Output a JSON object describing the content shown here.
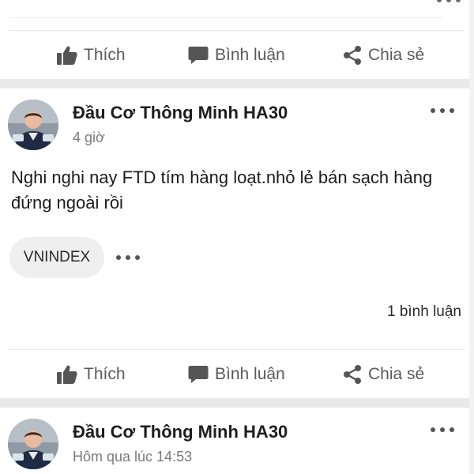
{
  "actions": {
    "like": "Thích",
    "comment": "Bình luận",
    "share": "Chia sẻ"
  },
  "posts": [
    {
      "author": "Đầu Cơ Thông Minh HA30",
      "time": "4 giờ",
      "text": "Nghi nghi nay FTD tím hàng loạt.nhỏ lẻ bán sạch hàng đứng ngoài rồi",
      "tag": "VNINDEX",
      "comments": "1 bình luận"
    },
    {
      "author": "Đầu Cơ Thông Minh HA30",
      "time": "Hôm qua lúc 14:53"
    }
  ],
  "colors": {
    "text": "#1c1c1c",
    "muted": "#7a7a7a",
    "action": "#5a5a5a",
    "separator": "#e9e9e9",
    "tag_bg": "#efefef"
  },
  "icons": [
    "thumbs-up-icon",
    "comment-icon",
    "share-icon",
    "more-icon",
    "avatar"
  ]
}
